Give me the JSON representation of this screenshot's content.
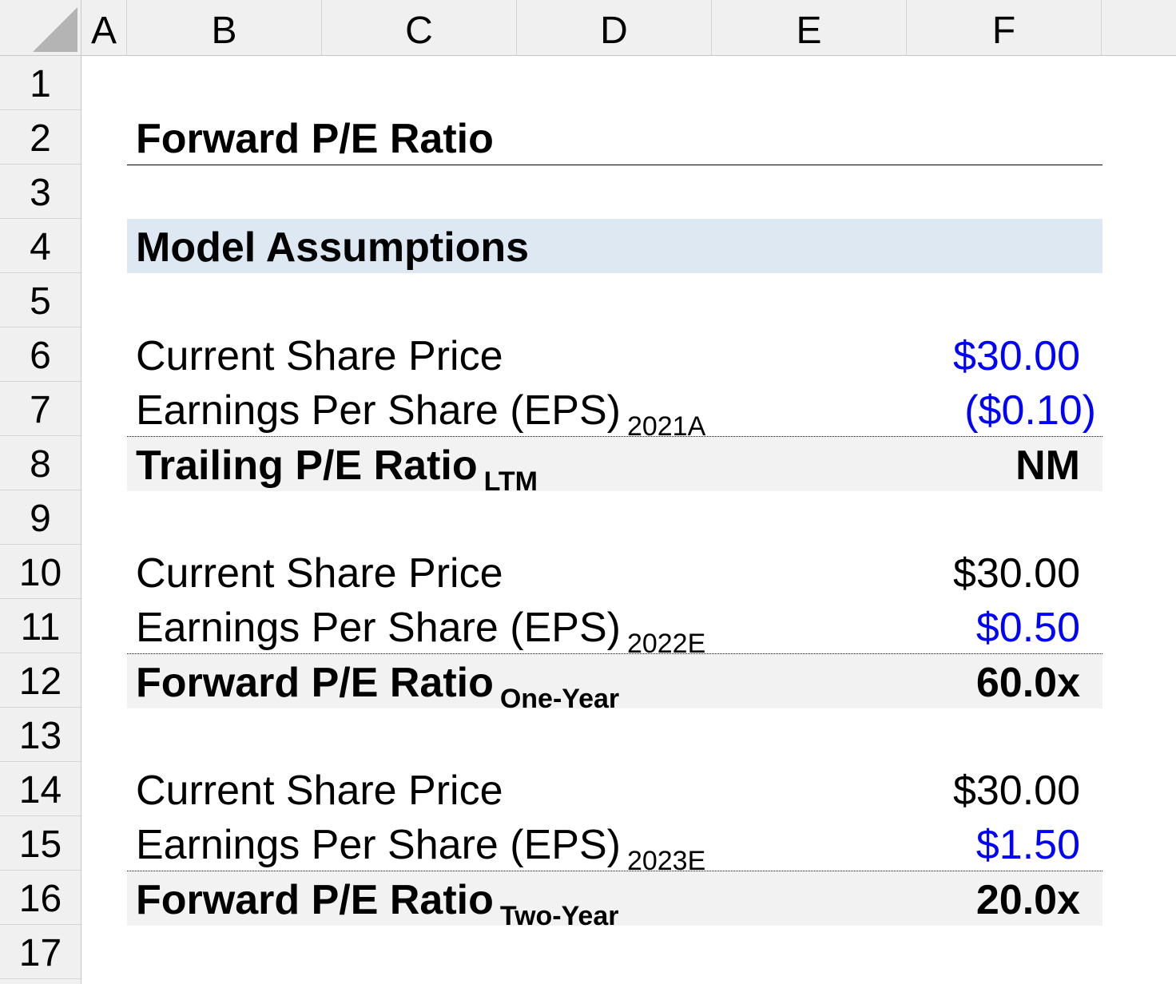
{
  "columns": [
    "A",
    "B",
    "C",
    "D",
    "E",
    "F"
  ],
  "rows": [
    "1",
    "2",
    "3",
    "4",
    "5",
    "6",
    "7",
    "8",
    "9",
    "10",
    "11",
    "12",
    "13",
    "14",
    "15",
    "16",
    "17"
  ],
  "title": "Forward P/E Ratio",
  "section": "Model Assumptions",
  "blocks": [
    {
      "price_label": "Current Share Price",
      "price_value": "$30.00",
      "eps_label": "Earnings Per Share (EPS)",
      "eps_sub": "2021A",
      "eps_value": "($0.10)",
      "ratio_label": "Trailing P/E Ratio",
      "ratio_sub": "LTM",
      "ratio_value": "NM"
    },
    {
      "price_label": "Current Share Price",
      "price_value": "$30.00",
      "eps_label": "Earnings Per Share (EPS)",
      "eps_sub": "2022E",
      "eps_value": "$0.50",
      "ratio_label": "Forward P/E Ratio",
      "ratio_sub": "One-Year",
      "ratio_value": "60.0x"
    },
    {
      "price_label": "Current Share Price",
      "price_value": "$30.00",
      "eps_label": "Earnings Per Share (EPS)",
      "eps_sub": "2023E",
      "eps_value": "$1.50",
      "ratio_label": "Forward P/E Ratio",
      "ratio_sub": "Two-Year",
      "ratio_value": "20.0x"
    }
  ],
  "colors": {
    "input_blue": "#0000ff",
    "section_fill": "#dde8f3",
    "total_fill": "#f2f2f2",
    "header_fill": "#f0f0f0"
  }
}
